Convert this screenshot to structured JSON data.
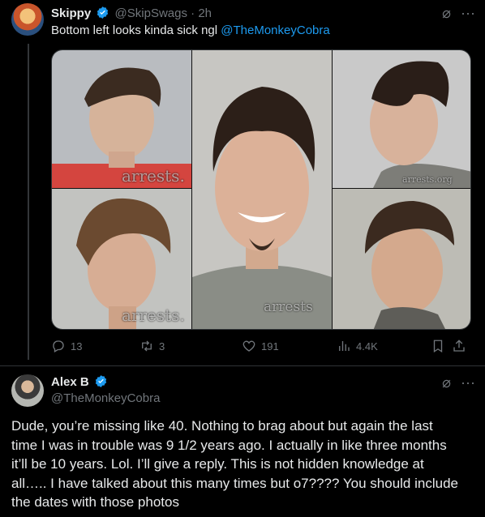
{
  "tweet1": {
    "name": "Skippy",
    "handle": "@SkipSwags",
    "separator": "·",
    "time": "2h",
    "text_prefix": "Bottom left looks kinda sick ngl ",
    "mention": "@TheMonkeyCobra",
    "photos": [
      {
        "position": "top-left",
        "watermark": "arrests."
      },
      {
        "position": "center",
        "watermark": "arrests"
      },
      {
        "position": "top-right",
        "watermark": "arrests.org"
      },
      {
        "position": "bottom-left",
        "watermark": "arrests."
      },
      {
        "position": "bottom-right",
        "watermark": ""
      }
    ],
    "stats": {
      "replies": "13",
      "reposts": "3",
      "likes": "191",
      "views": "4.4K"
    }
  },
  "tweet2": {
    "name": "Alex B",
    "handle": "@TheMonkeyCobra",
    "text_lines": [
      "Dude, you’re missing like 40.  Nothing to brag about but again the last",
      "time I was in trouble was 9 1/2 years ago. I actually in like three months",
      "it’ll be 10 years.  Lol. I’ll give a reply.    This is not hidden knowledge at",
      "all….. I have talked about this many times but o7???? You should include",
      "the dates with those photos"
    ]
  },
  "colors": {
    "background": "#000000",
    "text": "#e7e9ea",
    "muted": "#71767b",
    "accent": "#1d9bf0",
    "divider": "#2f3336"
  },
  "icons": [
    "verified-badge-icon",
    "grok-icon",
    "more-icon",
    "reply-icon",
    "repost-icon",
    "like-icon",
    "views-icon",
    "bookmark-icon",
    "share-icon"
  ]
}
